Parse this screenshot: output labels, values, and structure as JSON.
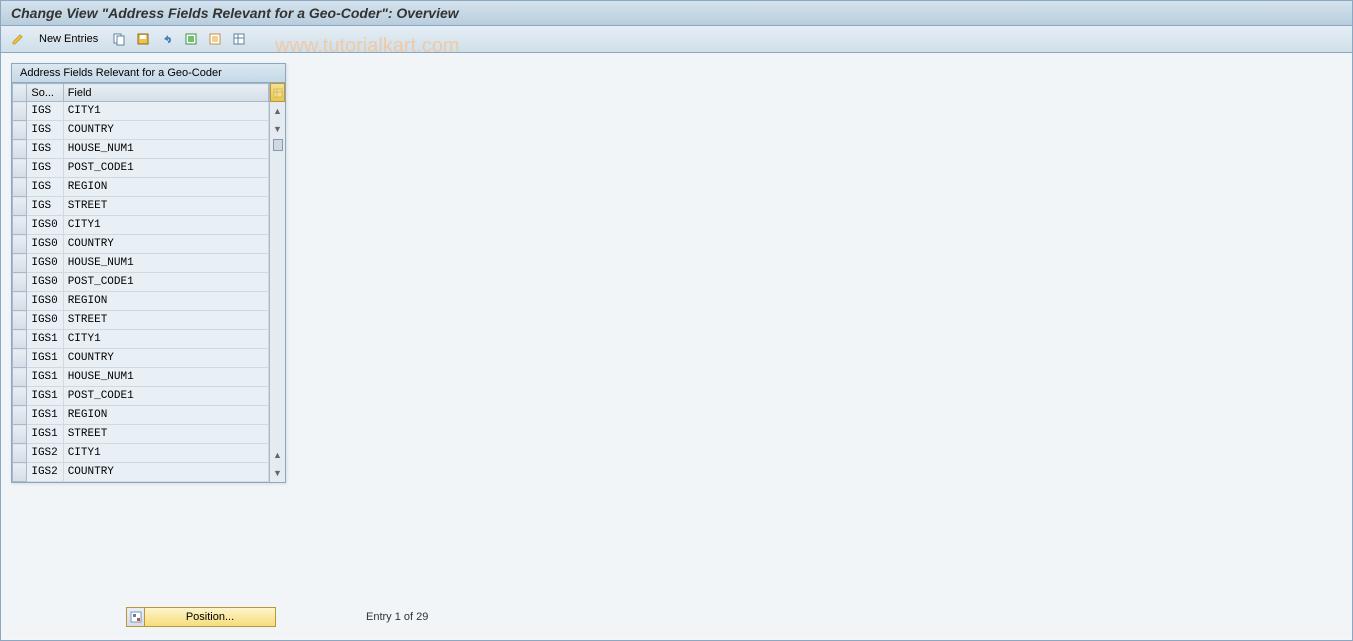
{
  "title": "Change View \"Address Fields Relevant for a Geo-Coder\": Overview",
  "watermark": "www.tutorialkart.com",
  "toolbar": {
    "new_entries": "New Entries"
  },
  "panel": {
    "title": "Address Fields Relevant for a Geo-Coder",
    "columns": {
      "so": "So...",
      "field": "Field"
    }
  },
  "rows": [
    {
      "so": "IGS",
      "field": "CITY1"
    },
    {
      "so": "IGS",
      "field": "COUNTRY"
    },
    {
      "so": "IGS",
      "field": "HOUSE_NUM1"
    },
    {
      "so": "IGS",
      "field": "POST_CODE1"
    },
    {
      "so": "IGS",
      "field": "REGION"
    },
    {
      "so": "IGS",
      "field": "STREET"
    },
    {
      "so": "IGS0",
      "field": "CITY1"
    },
    {
      "so": "IGS0",
      "field": "COUNTRY"
    },
    {
      "so": "IGS0",
      "field": "HOUSE_NUM1"
    },
    {
      "so": "IGS0",
      "field": "POST_CODE1"
    },
    {
      "so": "IGS0",
      "field": "REGION"
    },
    {
      "so": "IGS0",
      "field": "STREET"
    },
    {
      "so": "IGS1",
      "field": "CITY1"
    },
    {
      "so": "IGS1",
      "field": "COUNTRY"
    },
    {
      "so": "IGS1",
      "field": "HOUSE_NUM1"
    },
    {
      "so": "IGS1",
      "field": "POST_CODE1"
    },
    {
      "so": "IGS1",
      "field": "REGION"
    },
    {
      "so": "IGS1",
      "field": "STREET"
    },
    {
      "so": "IGS2",
      "field": "CITY1"
    },
    {
      "so": "IGS2",
      "field": "COUNTRY"
    }
  ],
  "footer": {
    "position_label": "Position...",
    "entry_status": "Entry 1 of 29"
  }
}
